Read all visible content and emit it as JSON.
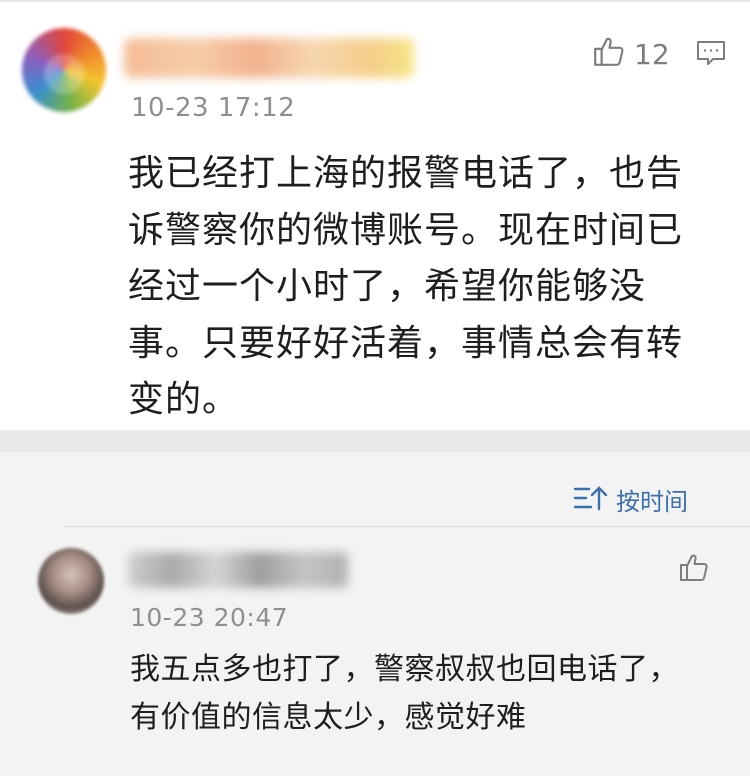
{
  "main_comment": {
    "username": "",
    "timestamp": "10-23 17:12",
    "like_count": "12",
    "text": "我已经打上海的报警电话了，也告诉警察你的微博账号。现在时间已经过一个小时了，希望你能够没事。只要好好活着，事情总会有转变的。"
  },
  "replies_section": {
    "sort_label": "按时间",
    "replies": [
      {
        "username": "",
        "timestamp": "10-23 20:47",
        "text": "我五点多也打了，警察叔叔也回电话了，有价值的信息太少，感觉好难"
      }
    ]
  },
  "colors": {
    "accent_blue": "#3a6fb0",
    "meta_gray": "#8f8f8f",
    "text_dark": "#1e1e1e",
    "section_bg": "#f3f3f3"
  },
  "icons": {
    "like": "thumbs-up-icon",
    "reply": "comment-bubble-icon",
    "sort": "sort-by-time-icon"
  }
}
